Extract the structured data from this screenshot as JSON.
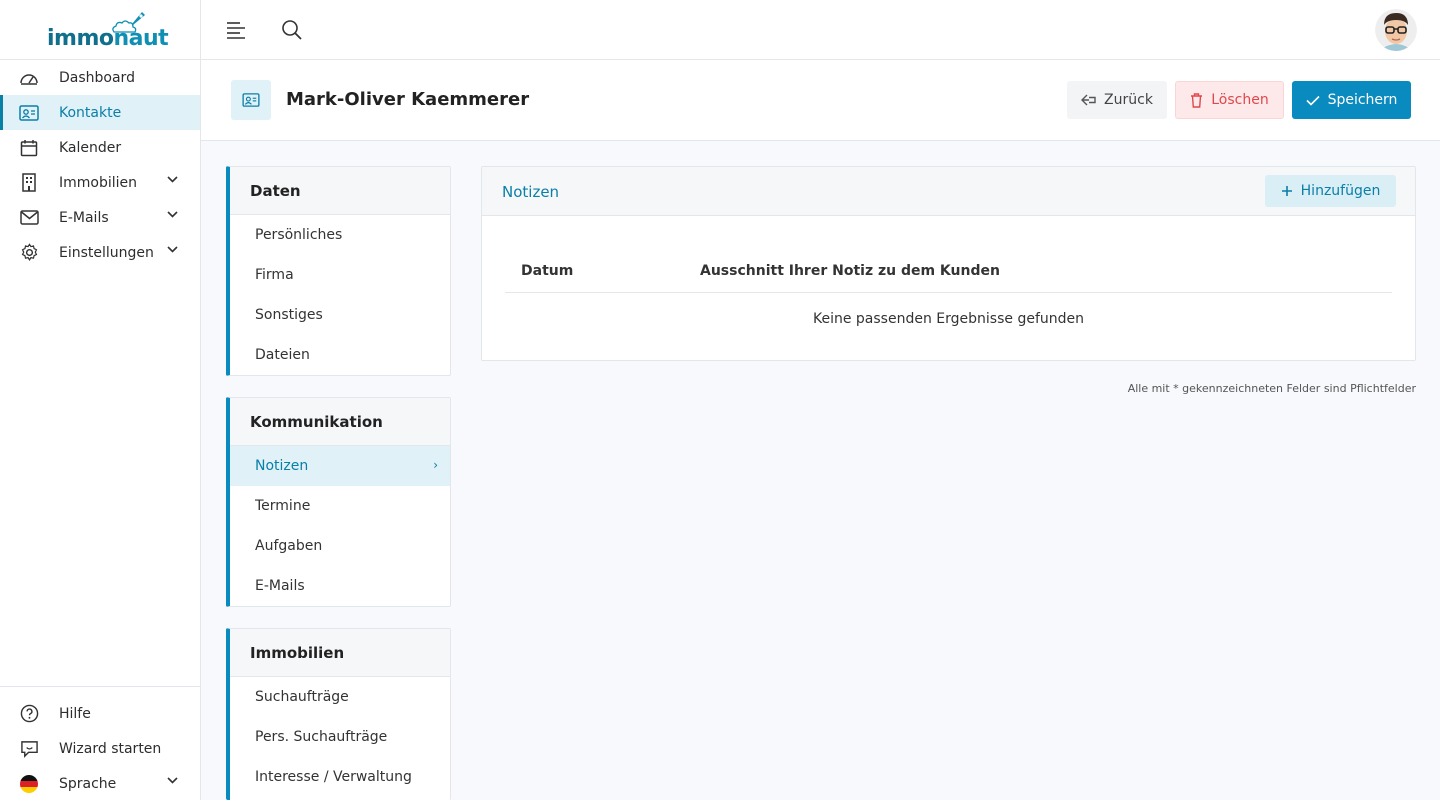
{
  "brand": {
    "name_prefix": "immo",
    "name_suffix": "naut"
  },
  "sidebar": {
    "items": [
      {
        "label": "Dashboard",
        "icon": "dashboard-icon"
      },
      {
        "label": "Kontakte",
        "icon": "contact-card-icon",
        "active": true
      },
      {
        "label": "Kalender",
        "icon": "calendar-icon"
      },
      {
        "label": "Immobilien",
        "icon": "building-icon",
        "has_submenu": true
      },
      {
        "label": "E-Mails",
        "icon": "mail-icon",
        "has_submenu": true
      },
      {
        "label": "Einstellungen",
        "icon": "gear-icon",
        "has_submenu": true
      }
    ],
    "bottom_items": [
      {
        "label": "Hilfe",
        "icon": "help-icon"
      },
      {
        "label": "Wizard starten",
        "icon": "wizard-icon"
      },
      {
        "label": "Sprache",
        "icon": "german-flag-icon",
        "has_submenu": true
      }
    ]
  },
  "header": {
    "title": "Mark-Oliver Kaemmerer",
    "back_label": "Zurück",
    "delete_label": "Löschen",
    "save_label": "Speichern"
  },
  "subnav": {
    "groups": [
      {
        "title": "Daten",
        "items": [
          "Persönliches",
          "Firma",
          "Sonstiges",
          "Dateien"
        ]
      },
      {
        "title": "Kommunikation",
        "items": [
          "Notizen",
          "Termine",
          "Aufgaben",
          "E-Mails"
        ],
        "active_item": "Notizen"
      },
      {
        "title": "Immobilien",
        "items": [
          "Suchaufträge",
          "Pers. Suchaufträge",
          "Interesse / Verwaltung"
        ]
      }
    ]
  },
  "notes_panel": {
    "title": "Notizen",
    "add_label": "Hinzufügen",
    "columns": [
      "Datum",
      "Ausschnitt Ihrer Notiz zu dem Kunden"
    ],
    "empty_text": "Keine passenden Ergebnisse gefunden"
  },
  "footnote": "Alle mit * gekennzeichneten Felder sind Pflichtfelder",
  "colors": {
    "accent": "#0a8bbf",
    "accent_light": "#e0f1f7",
    "danger": "#e0474c"
  }
}
